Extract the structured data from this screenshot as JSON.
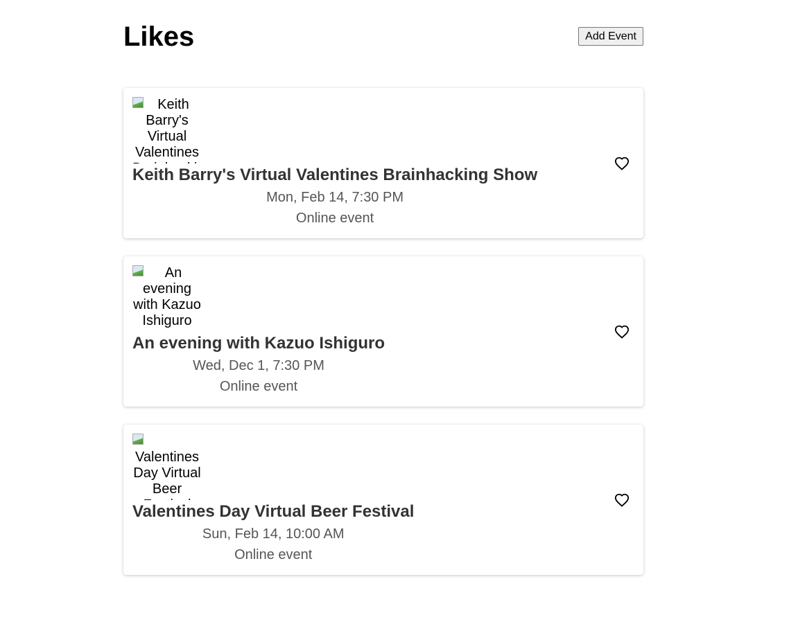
{
  "header": {
    "title": "Likes",
    "add_event_label": "Add Event"
  },
  "events": [
    {
      "image_alt": "Keith Barry's Virtual Valentines Brainhacking Show",
      "title": "Keith Barry's Virtual Valentines Brainhacking Show",
      "date": "Mon, Feb 14, 7:30 PM",
      "location": "Online event",
      "liked_icon": "heart-outline-icon"
    },
    {
      "image_alt": "An evening with Kazuo Ishiguro",
      "title": "An evening with Kazuo Ishiguro",
      "date": "Wed, Dec 1, 7:30 PM",
      "location": "Online event",
      "liked_icon": "heart-outline-icon"
    },
    {
      "image_alt": "Valentines Day Virtual Beer Festival",
      "title": "Valentines Day Virtual Beer Festival",
      "date": "Sun, Feb 14, 10:00 AM",
      "location": "Online event",
      "liked_icon": "heart-outline-icon"
    }
  ]
}
